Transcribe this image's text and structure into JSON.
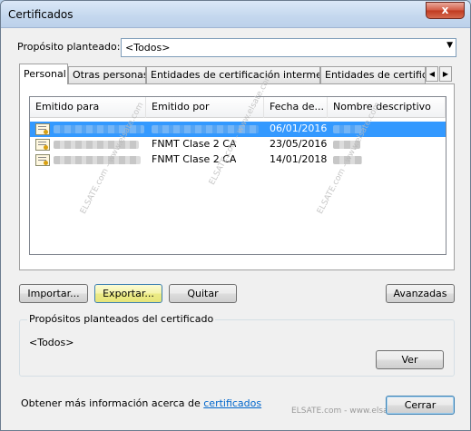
{
  "window": {
    "title": "Certificados",
    "close_glyph": "x"
  },
  "purpose": {
    "label": "Propósito planteado:",
    "value": "<Todos>"
  },
  "tabs": [
    {
      "label": "Personal",
      "active": true
    },
    {
      "label": "Otras personas",
      "active": false
    },
    {
      "label": "Entidades de certificación intermedias",
      "active": false
    },
    {
      "label": "Entidades de certificaci",
      "active": false
    }
  ],
  "tab_scroll": {
    "left_icon": "chevron-left-icon",
    "right_icon": "chevron-right-icon"
  },
  "list": {
    "columns": [
      "Emitido para",
      "Emitido por",
      "Fecha de...",
      "Nombre descriptivo"
    ],
    "rows": [
      {
        "issued_to": "",
        "issued_by": "",
        "date": "06/01/2016",
        "friendly_name": "",
        "selected": true
      },
      {
        "issued_to": "",
        "issued_by": "FNMT Clase 2 CA",
        "date": "23/05/2016",
        "friendly_name": "",
        "selected": false
      },
      {
        "issued_to": "",
        "issued_by": "FNMT Clase 2 CA",
        "date": "14/01/2018",
        "friendly_name": "",
        "selected": false
      }
    ]
  },
  "buttons": {
    "import": "Importar...",
    "export": "Exportar...",
    "remove": "Quitar",
    "advanced": "Avanzadas",
    "view": "Ver",
    "close": "Cerrar"
  },
  "group": {
    "title": "Propósitos planteados del certificado",
    "value": "<Todos>"
  },
  "info": {
    "text": "Obtener más información acerca de ",
    "link": "certificados"
  },
  "watermarks": [
    "ELSATE.com - www.elsate.com",
    "ELSATE.com - www.elsate.com",
    "ELSATE.com - www.elsate.com",
    "ELSATE.com - www.elsate.com"
  ],
  "colors": {
    "selection": "#3399ff",
    "link": "#0066cc",
    "hot_button": "#f5f4a8"
  }
}
